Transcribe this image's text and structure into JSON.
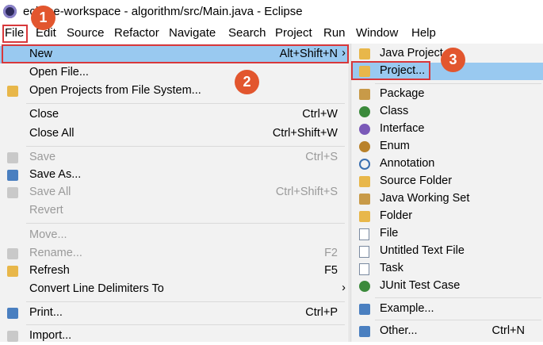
{
  "window": {
    "title": "eclipse-workspace - algorithm/src/Main.java - Eclipse"
  },
  "menubar": {
    "items": [
      "File",
      "Edit",
      "Source",
      "Refactor",
      "Navigate",
      "Search",
      "Project",
      "Run",
      "Window",
      "Help"
    ]
  },
  "file_menu": {
    "items": [
      {
        "label": "New",
        "shortcut": "Alt+Shift+N",
        "submenu": true
      },
      {
        "label": "Open File..."
      },
      {
        "label": "Open Projects from File System..."
      },
      {
        "label": "Close",
        "shortcut": "Ctrl+W"
      },
      {
        "label": "Close All",
        "shortcut": "Ctrl+Shift+W"
      },
      {
        "label": "Save",
        "shortcut": "Ctrl+S",
        "disabled": true
      },
      {
        "label": "Save As..."
      },
      {
        "label": "Save All",
        "shortcut": "Ctrl+Shift+S",
        "disabled": true
      },
      {
        "label": "Revert",
        "disabled": true
      },
      {
        "label": "Move...",
        "disabled": true
      },
      {
        "label": "Rename...",
        "shortcut": "F2",
        "disabled": true
      },
      {
        "label": "Refresh",
        "shortcut": "F5"
      },
      {
        "label": "Convert Line Delimiters To",
        "submenu": true
      },
      {
        "label": "Print...",
        "shortcut": "Ctrl+P"
      },
      {
        "label": "Import..."
      }
    ]
  },
  "new_submenu": {
    "items": [
      {
        "label": "Java Project",
        "icon": "java-project-icon"
      },
      {
        "label": "Project...",
        "icon": "project-icon"
      },
      {
        "label": "Package",
        "icon": "package-icon"
      },
      {
        "label": "Class",
        "icon": "class-icon"
      },
      {
        "label": "Interface",
        "icon": "interface-icon"
      },
      {
        "label": "Enum",
        "icon": "enum-icon"
      },
      {
        "label": "Annotation",
        "icon": "annotation-icon"
      },
      {
        "label": "Source Folder",
        "icon": "source-folder-icon"
      },
      {
        "label": "Java Working Set",
        "icon": "working-set-icon"
      },
      {
        "label": "Folder",
        "icon": "folder-icon"
      },
      {
        "label": "File",
        "icon": "file-icon"
      },
      {
        "label": "Untitled Text File",
        "icon": "text-file-icon"
      },
      {
        "label": "Task",
        "icon": "task-icon"
      },
      {
        "label": "JUnit Test Case",
        "icon": "junit-icon"
      },
      {
        "label": "Example...",
        "icon": "example-icon"
      },
      {
        "label": "Other...",
        "shortcut": "Ctrl+N",
        "icon": "other-icon"
      }
    ]
  },
  "annotations": {
    "step1": "1",
    "step2": "2",
    "step3": "3",
    "color": "#e2562e",
    "box_color": "#d8383b"
  },
  "colors": {
    "highlight": "#99c9f0",
    "menu_bg": "#f2f2f2",
    "disabled_text": "#9a9a9a"
  }
}
